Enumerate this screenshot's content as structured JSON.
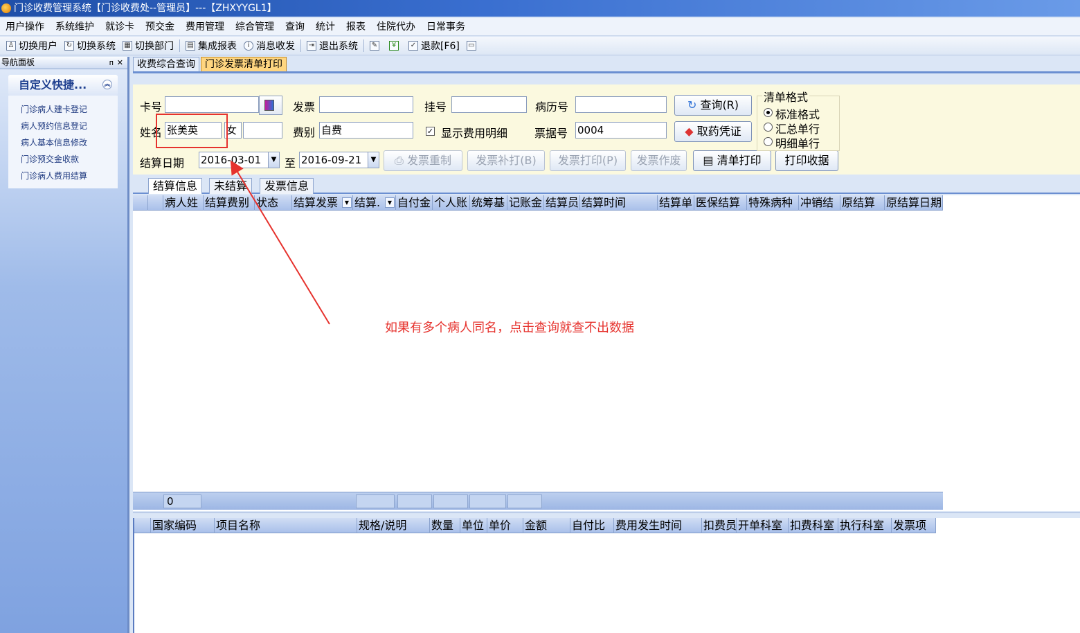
{
  "window": {
    "title": "门诊收费管理系统【门诊收费处--管理员】---【ZHXYYGL1】"
  },
  "menubar": {
    "items": [
      "用户操作",
      "系统维护",
      "就诊卡",
      "预交金",
      "费用管理",
      "综合管理",
      "查询",
      "统计",
      "报表",
      "住院代办",
      "日常事务"
    ]
  },
  "toolbar": {
    "items": [
      {
        "label": "切换用户",
        "icon": "switch-user-icon"
      },
      {
        "label": "切换系统",
        "icon": "switch-system-icon"
      },
      {
        "label": "切换部门",
        "icon": "switch-department-icon"
      },
      {
        "label": "集成报表",
        "icon": "report-icon"
      },
      {
        "label": "消息收发",
        "icon": "message-icon"
      },
      {
        "label": "退出系统",
        "icon": "exit-icon"
      }
    ],
    "refund_label": "退款[F6]"
  },
  "nav": {
    "panel_title": "导航面板",
    "pin_glyph": "ᴨ",
    "close_glyph": "✕",
    "group_title": "自定义快捷...",
    "links": [
      "门诊病人建卡登记",
      "病人预约信息登记",
      "病人基本信息修改",
      "门诊预交金收款",
      "门诊病人费用结算"
    ]
  },
  "doc_tabs": [
    "收费综合查询",
    "门诊发票清单打印"
  ],
  "form": {
    "card_label": "卡号",
    "card_value": "",
    "invoice_label": "发票",
    "invoice_value": "",
    "register_label": "挂号",
    "register_value": "",
    "record_label": "病历号",
    "record_value": "",
    "query_label": "查询(R)",
    "name_label": "姓名",
    "name_value": "张美英",
    "sex_value": "女",
    "age_value": "",
    "fee_type_label": "费别",
    "fee_type_value": "自费",
    "show_detail_label": "显示费用明细",
    "show_detail_checked": true,
    "receipt_label": "票据号",
    "receipt_value": "0004",
    "pickup_voucher_label": "取药凭证",
    "date_label": "结算日期",
    "date_from": "2016-03-01",
    "date_to_label": "至",
    "date_to": "2016-09-21",
    "reset_invoice_label": "发票重制",
    "reprint_invoice_label": "发票补打(B)",
    "print_invoice_label": "发票打印(P)",
    "void_invoice_label": "发票作废",
    "print_list_label": "清单打印",
    "print_receipt_label": "打印收据",
    "format_group_label": "清单格式",
    "format_options": [
      "标准格式",
      "汇总单行",
      "明细单行"
    ],
    "format_selected": "标准格式"
  },
  "inner_tabs": [
    "结算信息",
    "未结算",
    "发票信息"
  ],
  "settle_grid": {
    "columns": [
      "病人姓",
      "结算费别",
      "状态",
      "结算发票",
      "结算.",
      "自付金",
      "个人账",
      "统筹基",
      "记账金",
      "结算员",
      "结算时间",
      "结算单",
      "医保结算",
      "特殊病种",
      "冲销结",
      "原结算",
      "原结算日期"
    ],
    "footer_count": "0"
  },
  "detail_grid": {
    "columns": [
      "国家编码",
      "项目名称",
      "规格/说明",
      "数量",
      "单位",
      "单价",
      "金额",
      "自付比",
      "费用发生时间",
      "扣费员",
      "开单科室",
      "扣费科室",
      "执行科室",
      "发票项"
    ]
  },
  "annotation": {
    "text": "如果有多个病人同名，点击查询就查不出数据",
    "color": "#e6322d"
  }
}
